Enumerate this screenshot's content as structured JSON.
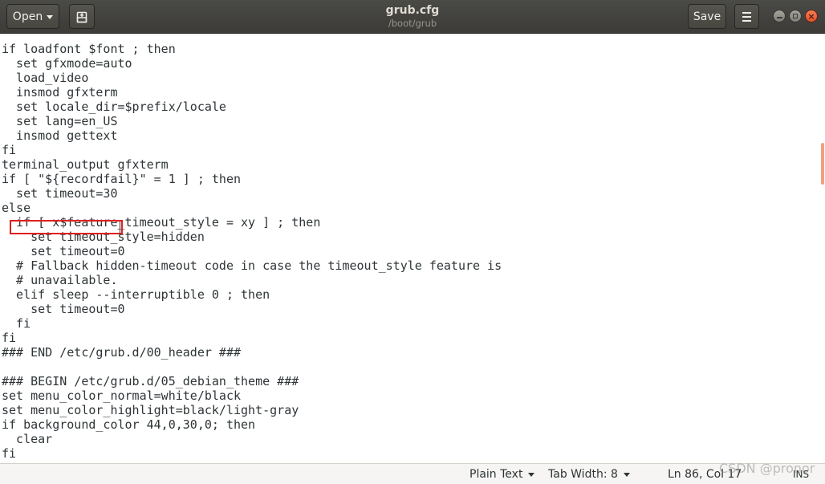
{
  "window": {
    "title": "grub.cfg",
    "subtitle": "/boot/grub"
  },
  "header": {
    "open_label": "Open",
    "save_label": "Save",
    "new_tab_icon": "new-document-icon",
    "menu_icon": "hamburger-menu-icon"
  },
  "window_controls": {
    "minimize_icon": "minimize-icon",
    "maximize_icon": "maximize-icon",
    "close_icon": "close-icon",
    "close_glyph": "×"
  },
  "editor": {
    "lines": [
      "if loadfont $font ; then",
      "  set gfxmode=auto",
      "  load_video",
      "  insmod gfxterm",
      "  set locale_dir=$prefix/locale",
      "  set lang=en_US",
      "  insmod gettext",
      "fi",
      "terminal_output gfxterm",
      "if [ \"${recordfail}\" = 1 ] ; then",
      "  set timeout=30",
      "else",
      "  if [ x$feature_timeout_style = xy ] ; then",
      "    set timeout_style=hidden",
      "    set timeout=0",
      "  # Fallback hidden-timeout code in case the timeout_style feature is",
      "  # unavailable.",
      "  elif sleep --interruptible 0 ; then",
      "    set timeout=0",
      "  fi",
      "fi",
      "### END /etc/grub.d/00_header ###",
      "",
      "### BEGIN /etc/grub.d/05_debian_theme ###",
      "set menu_color_normal=white/black",
      "set menu_color_highlight=black/light-gray",
      "if background_color 44,0,30,0; then",
      "  clear",
      "fi"
    ],
    "highlighted_line_index": 10
  },
  "statusbar": {
    "language": "Plain Text",
    "tab_width": "Tab Width: 8",
    "position": "Ln 86, Col 17",
    "mode": "INS"
  },
  "watermark": "CSDN @pronor",
  "colors": {
    "headerbar": "#3c3b37",
    "highlight_box": "#e02020",
    "close_button": "#e95420",
    "scroll_indicator": "#f2a17f"
  }
}
